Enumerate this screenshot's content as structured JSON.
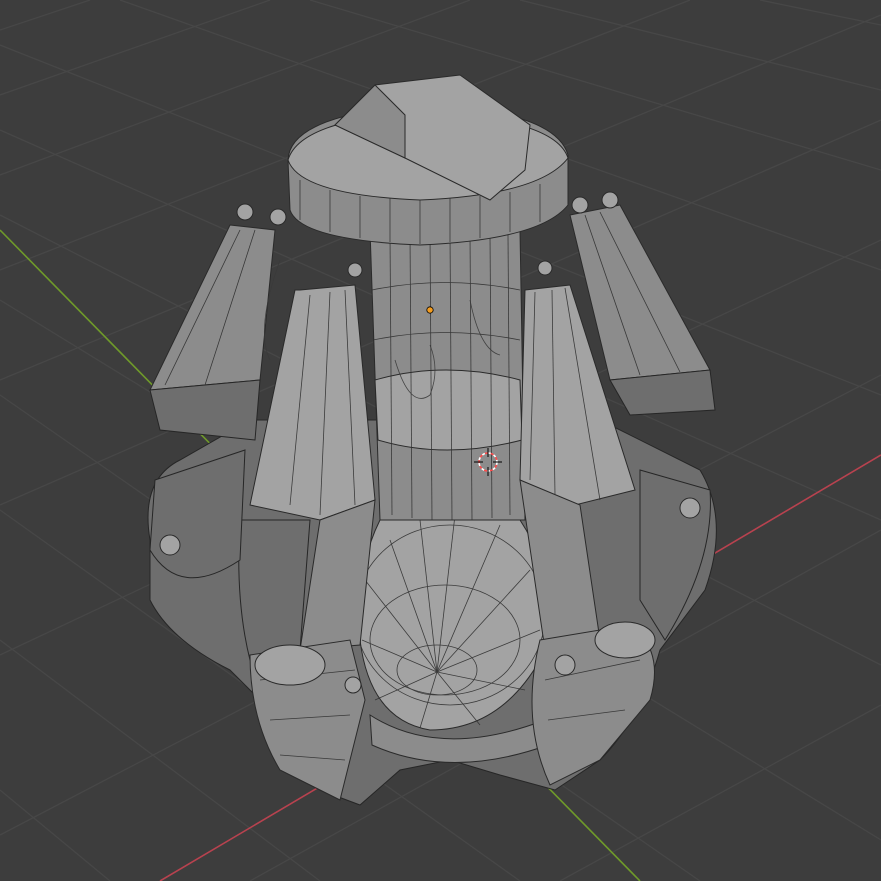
{
  "viewport": {
    "background": "#3d3d3d",
    "grid_color": "#474747",
    "x_axis_color": "#b8424f",
    "y_axis_color": "#6f9a2a",
    "mesh_base_color": "#8c8c8c",
    "wire_color": "#2a2a2a",
    "object_origin_color": "#f39c1f",
    "cursor_colors": [
      "#ff4a4a",
      "#ffffff"
    ]
  },
  "scene": {
    "object_icon": "orange-peel-grab-mesh",
    "origin_icon": "origin-dot-icon",
    "cursor_icon": "3d-cursor-icon"
  }
}
